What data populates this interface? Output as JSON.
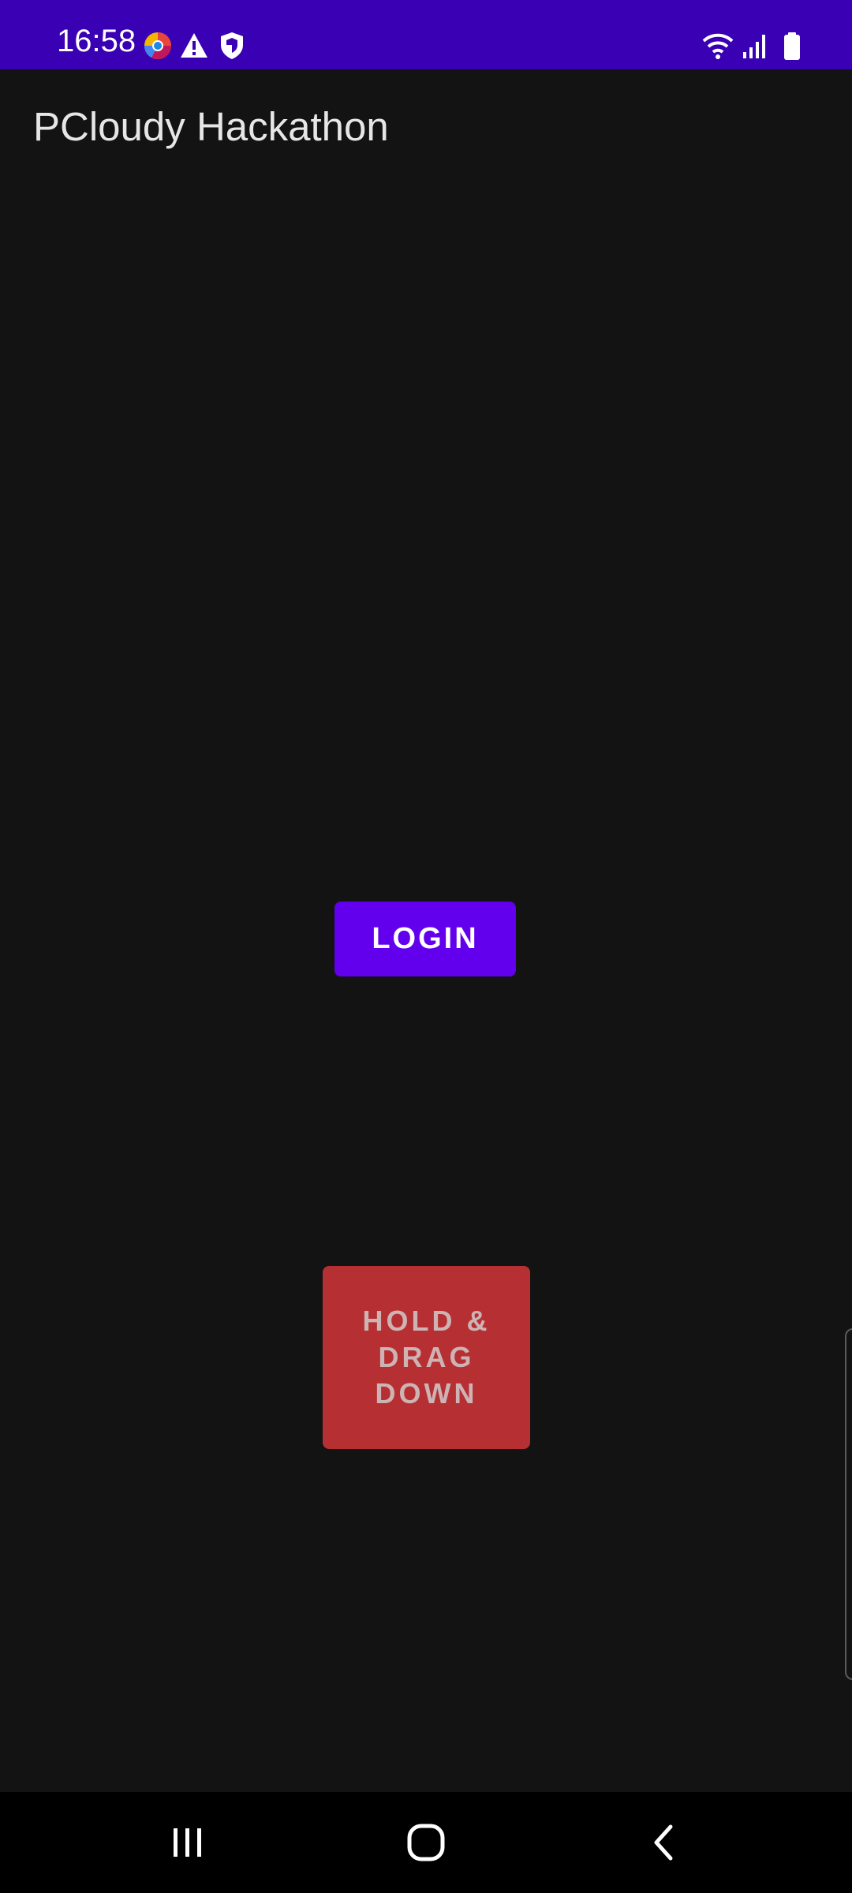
{
  "status_bar": {
    "time": "16:58",
    "icons": [
      "browser-app-icon",
      "warning-icon",
      "shield-icon",
      "wifi-icon",
      "signal-icon",
      "battery-icon"
    ],
    "color": "#3a00b4"
  },
  "app": {
    "title": "PCloudy Hackathon"
  },
  "main": {
    "login_label": "LOGIN",
    "login_color": "#6200ee",
    "drag_lines": [
      "HOLD &",
      "DRAG",
      "DOWN"
    ],
    "drag_color": "#b63033"
  },
  "nav_bar": {
    "icons": [
      "recent-apps-icon",
      "home-icon",
      "back-icon"
    ]
  }
}
